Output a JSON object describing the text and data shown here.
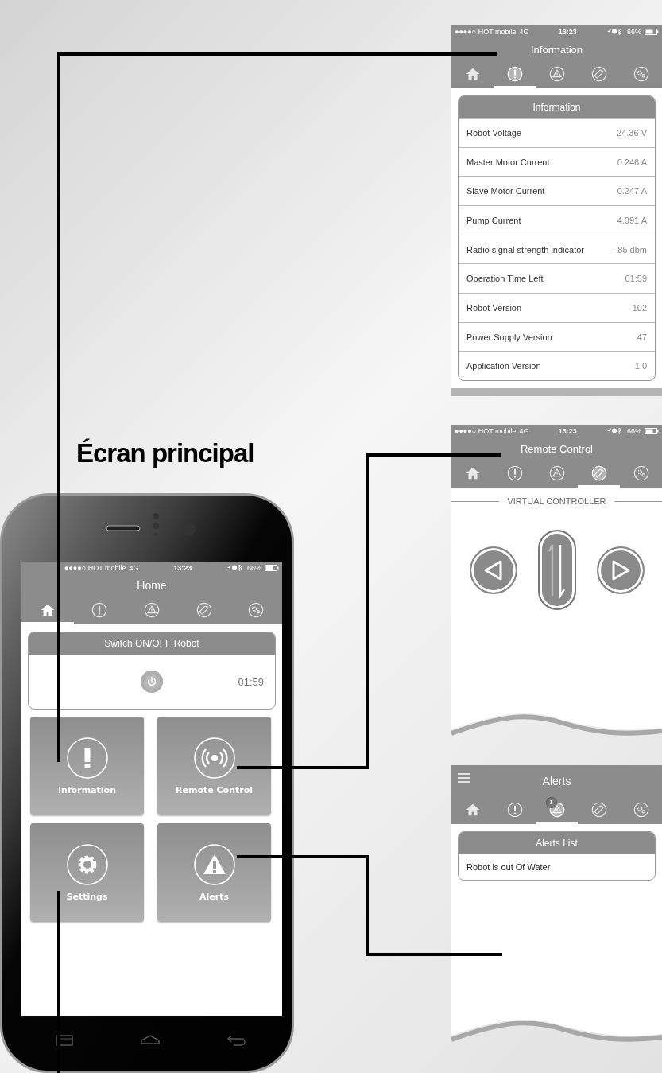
{
  "heading": "Écran principal",
  "home": {
    "status_bar": {
      "carrier": "●●●●○ HOT mobile",
      "network": "4G",
      "time": "13:23",
      "battery": "66%"
    },
    "title": "Home",
    "tabs": [
      {
        "kind": "home",
        "selected": true
      },
      {
        "kind": "information",
        "selected": false
      },
      {
        "kind": "alerts",
        "selected": false
      },
      {
        "kind": "remote",
        "selected": false
      },
      {
        "kind": "settings",
        "selected": false
      }
    ],
    "switch_card": {
      "title": "Switch ON/OFF Robot",
      "timer": "01:59"
    },
    "tiles": [
      {
        "kind": "information",
        "label": "Information"
      },
      {
        "kind": "remote",
        "label": "Remote Control"
      },
      {
        "kind": "settings",
        "label": "Settings"
      },
      {
        "kind": "alerts",
        "label": "Alerts"
      }
    ]
  },
  "information_screen": {
    "status_bar": {
      "carrier": "●●●●○ HOT mobile",
      "network": "4G",
      "time": "13:23",
      "battery": "66%"
    },
    "title": "Information",
    "tabs": [
      {
        "kind": "home",
        "selected": false
      },
      {
        "kind": "information",
        "selected": true
      },
      {
        "kind": "alerts",
        "selected": false
      },
      {
        "kind": "remote",
        "selected": false
      },
      {
        "kind": "settings",
        "selected": false
      }
    ],
    "table": {
      "title": "Information",
      "rows": [
        {
          "label": "Robot Voltage",
          "value": "24.36 V"
        },
        {
          "label": "Master Motor Current",
          "value": "0.246 A"
        },
        {
          "label": "Slave Motor Current",
          "value": "0.247 A"
        },
        {
          "label": "Pump Current",
          "value": "4.091 A"
        },
        {
          "label": "Radio signal strength indicator",
          "value": "-85 dbm"
        },
        {
          "label": "Operation Time Left",
          "value": "01:59"
        },
        {
          "label": "Robot Version",
          "value": "102"
        },
        {
          "label": "Power Supply Version",
          "value": "47"
        },
        {
          "label": "Application Version",
          "value": "1.0"
        }
      ]
    }
  },
  "remote_screen": {
    "status_bar": {
      "carrier": "●●●●○ HOT mobile",
      "network": "4G",
      "time": "13:23",
      "battery": "66%"
    },
    "title": "Remote Control",
    "tabs": [
      {
        "kind": "home",
        "selected": false
      },
      {
        "kind": "information",
        "selected": false
      },
      {
        "kind": "alerts",
        "selected": false
      },
      {
        "kind": "remote",
        "selected": true
      },
      {
        "kind": "settings",
        "selected": false
      }
    ],
    "section_label": "VIRTUAL CONTROLLER"
  },
  "alerts_screen": {
    "title": "Alerts",
    "tabs": [
      {
        "kind": "home",
        "selected": false
      },
      {
        "kind": "information",
        "selected": false
      },
      {
        "kind": "alerts",
        "selected": true,
        "badge": "1"
      },
      {
        "kind": "remote",
        "selected": false
      },
      {
        "kind": "settings",
        "selected": false
      }
    ],
    "list": {
      "title": "Alerts List",
      "items": [
        "Robot is out Of Water"
      ]
    }
  }
}
